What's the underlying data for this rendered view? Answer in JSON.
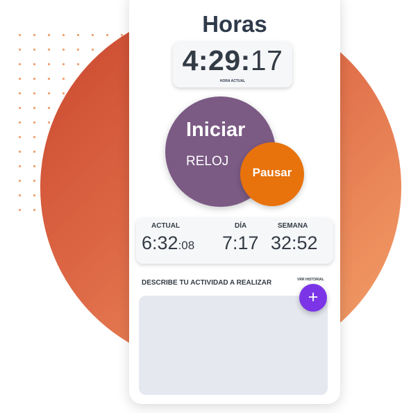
{
  "colors": {
    "accent_purple": "#7b5a84",
    "accent_orange": "#e8720c",
    "add_button": "#7b35e6",
    "title_text": "#2f3a4b",
    "circle_gradient": [
      "#c9462d",
      "#f2a46b"
    ]
  },
  "header": {
    "title": "Horas"
  },
  "clock": {
    "hours_minutes": "4:29:",
    "seconds": "17",
    "label": "HORA ACTUAL"
  },
  "controls": {
    "start_label": "Iniciar",
    "start_sublabel": "RELOJ",
    "pause_label": "Pausar"
  },
  "summary": {
    "actual": {
      "label": "ACTUAL",
      "value_main": "6:32",
      "value_small": ":08"
    },
    "dia": {
      "label": "DÍA",
      "value": "7:17"
    },
    "semana": {
      "label": "SEMANA",
      "value": "32:52"
    }
  },
  "activity": {
    "label": "DESCRIBE TU ACTIVIDAD A REALIZAR",
    "historial_label": "VRR HISTORIAL",
    "add_icon": "plus-icon",
    "add_glyph": "+",
    "text_value": ""
  }
}
